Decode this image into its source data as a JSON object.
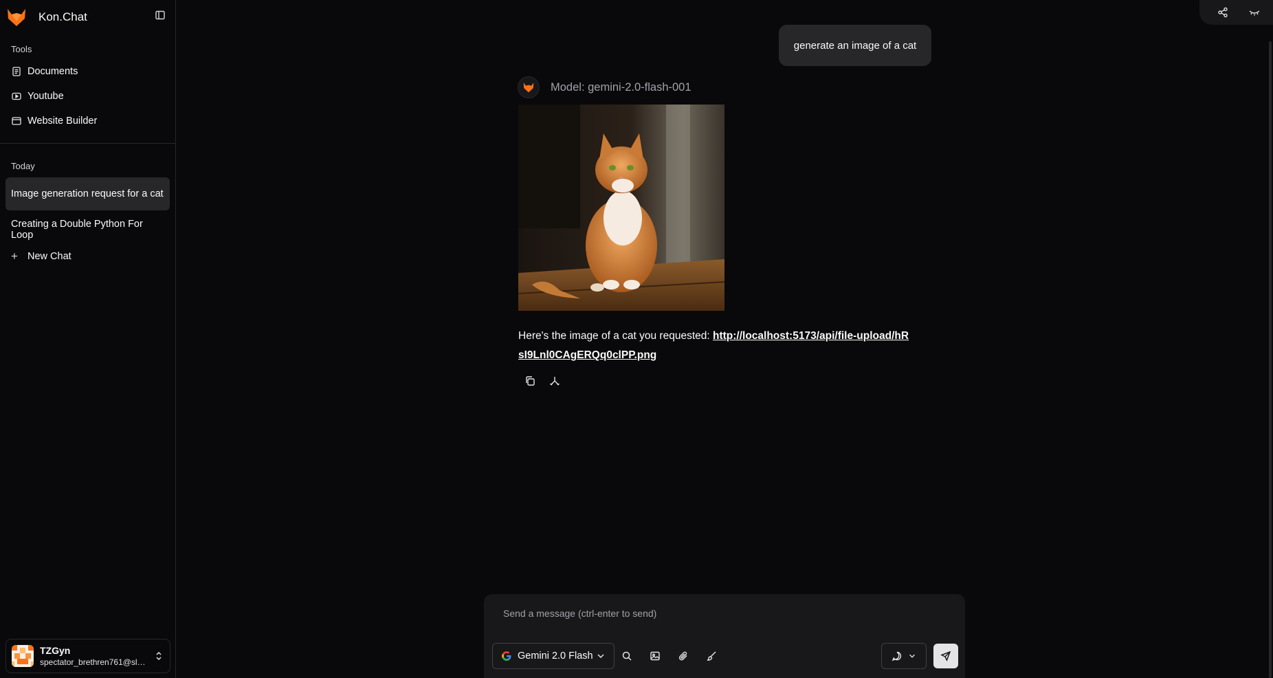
{
  "app": {
    "title": "Kon.Chat"
  },
  "sidebar": {
    "tools_label": "Tools",
    "tools": [
      {
        "label": "Documents",
        "icon": "document-icon"
      },
      {
        "label": "Youtube",
        "icon": "youtube-icon"
      },
      {
        "label": "Website Builder",
        "icon": "browser-window-icon"
      }
    ],
    "today_label": "Today",
    "chats": [
      {
        "label": "Image generation request for a cat",
        "active": true
      },
      {
        "label": "Creating a Double Python For Loop",
        "active": false
      }
    ],
    "new_chat_label": "New Chat",
    "user": {
      "name": "TZGyn",
      "email": "spectator_brethren761@slm..."
    }
  },
  "conversation": {
    "user_message": "generate an image of a cat",
    "assistant": {
      "model_label": "Model: gemini-2.0-flash-001",
      "image_subject": "orange tabby cat sitting on a wooden table",
      "response_text": "Here's the image of a cat you requested: ",
      "response_link": "http://localhost:5173/api/file-upload/hRsI9Lnl0CAgERQq0clPP.png"
    }
  },
  "composer": {
    "placeholder": "Send a message (ctrl-enter to send)",
    "model_name": "Gemini 2.0 Flash"
  },
  "colors": {
    "background": "#09090b",
    "surface": "#18181b",
    "active": "#27272a",
    "brand_orange": "#f97316"
  }
}
